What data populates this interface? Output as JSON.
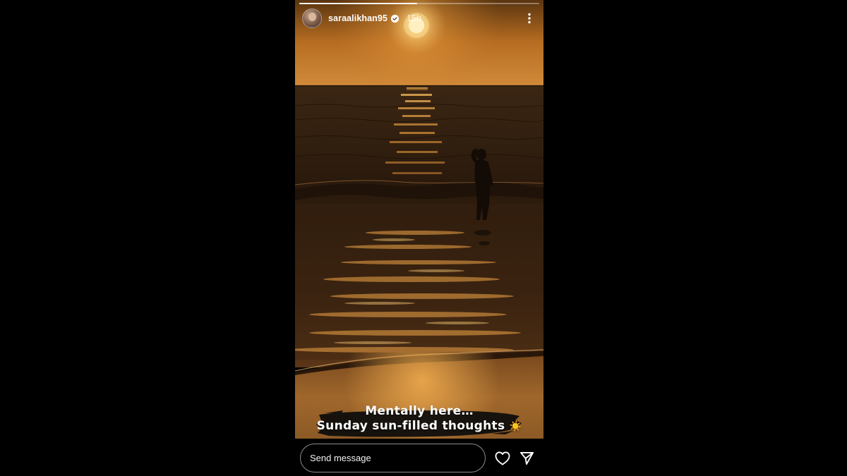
{
  "story": {
    "username": "saraalikhan95",
    "verified": true,
    "time_ago": "15h",
    "progress": 0.49
  },
  "media": {
    "caption_line1": "Mentally here…",
    "caption_line2": "Sunday sun-filled thoughts",
    "caption_emoji": "☀️"
  },
  "footer": {
    "send_placeholder": "Send message"
  },
  "icons": {
    "avatar": "avatar",
    "verified": "verified-badge-icon",
    "more": "more-options-icon",
    "like": "heart-icon",
    "share": "send-icon"
  },
  "colors": {
    "background": "#000000",
    "sky_top": "#6b3d10",
    "sun": "#fff2c0",
    "sea": "#3a2512"
  }
}
